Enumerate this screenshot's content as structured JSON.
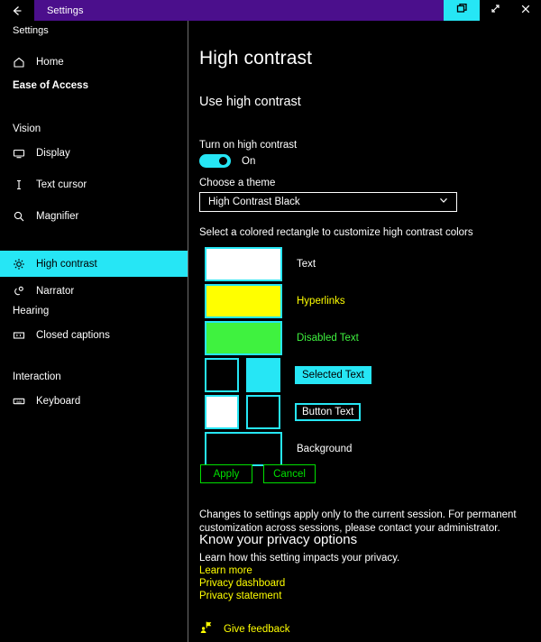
{
  "titlebar": {
    "app_title": "Settings",
    "back_icon": "back-arrow-icon",
    "restore_icon": "restore-window-icon",
    "maximize_icon": "maximize-window-icon",
    "close_icon": "close-window-icon"
  },
  "sidebar": {
    "app_name": "Settings",
    "home": {
      "label": "Home",
      "icon": "home-icon"
    },
    "category": "Ease of Access",
    "groups": [
      {
        "heading": "Vision"
      },
      {
        "heading": "Hearing"
      },
      {
        "heading": "Interaction"
      }
    ],
    "items": [
      {
        "label": "Display",
        "icon": "monitor-icon",
        "selected": false
      },
      {
        "label": "Text cursor",
        "icon": "text-cursor-icon",
        "selected": false
      },
      {
        "label": "Magnifier",
        "icon": "magnifier-icon",
        "selected": false
      },
      {
        "label": "High contrast",
        "icon": "brightness-icon",
        "selected": true
      },
      {
        "label": "Narrator",
        "icon": "narrator-icon",
        "selected": false
      },
      {
        "label": "Closed captions",
        "icon": "closed-captions-icon",
        "selected": false
      },
      {
        "label": "Keyboard",
        "icon": "keyboard-icon",
        "selected": false
      }
    ]
  },
  "main": {
    "page_title": "High contrast",
    "section_title": "Use high contrast",
    "toggle": {
      "label": "Turn on high contrast",
      "state": "On",
      "on": true
    },
    "theme": {
      "label": "Choose a theme",
      "selected": "High Contrast Black",
      "chevron_icon": "chevron-down-icon"
    },
    "swatch_helper": "Select a colored rectangle to customize high contrast colors",
    "swatches": [
      {
        "label": "Text",
        "label_style": "plain",
        "label_color": "#ffffff",
        "boxes": [
          {
            "fill": "#ffffff"
          }
        ]
      },
      {
        "label": "Hyperlinks",
        "label_style": "plain",
        "label_color": "#ffff00",
        "boxes": [
          {
            "fill": "#ffff00"
          }
        ]
      },
      {
        "label": "Disabled Text",
        "label_style": "plain",
        "label_color": "#3ff23f",
        "boxes": [
          {
            "fill": "#3ff23f"
          }
        ]
      },
      {
        "label": "Selected Text",
        "label_style": "boxed",
        "label_color": "#000000",
        "label_bg": "#26e6f5",
        "boxes": [
          {
            "fill": "#000000"
          },
          {
            "fill": "#26e6f5"
          }
        ]
      },
      {
        "label": "Button Text",
        "label_style": "boxed",
        "label_color": "#ffffff",
        "label_bg": "#000000",
        "boxes": [
          {
            "fill": "#ffffff"
          },
          {
            "fill": "#000000"
          }
        ]
      },
      {
        "label": "Background",
        "label_style": "plain",
        "label_color": "#ffffff",
        "boxes": [
          {
            "fill": "#000000"
          }
        ]
      }
    ],
    "buttons": {
      "apply": "Apply",
      "cancel": "Cancel"
    },
    "note": "Changes to settings apply only to the current session. For permanent customization across sessions, please contact your administrator.",
    "privacy": {
      "heading": "Know your privacy options",
      "subtext": "Learn how this setting impacts your privacy.",
      "links": [
        "Learn more",
        "Privacy dashboard",
        "Privacy statement"
      ]
    },
    "feedback": {
      "label": "Give feedback",
      "icon": "feedback-person-icon"
    }
  },
  "colors": {
    "accent_cyan": "#26e6f5",
    "title_purple": "#4b0f8c",
    "link_yellow": "#ffff00",
    "button_green": "#00e000",
    "disabled_green": "#3ff23f",
    "background": "#000000"
  }
}
